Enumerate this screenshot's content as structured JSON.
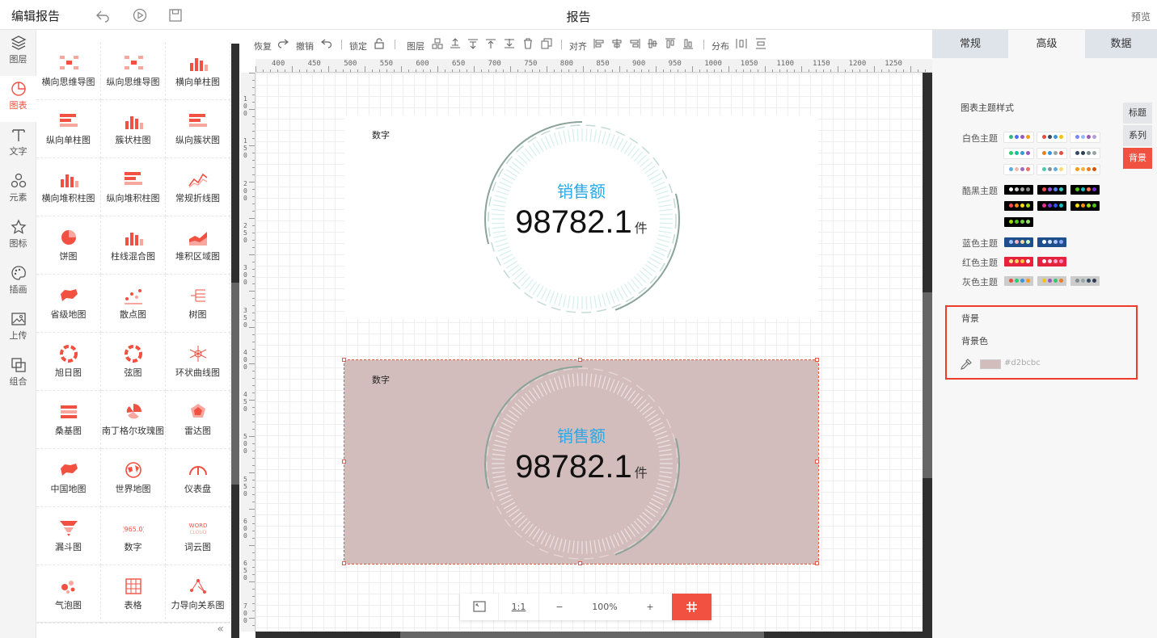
{
  "header": {
    "title": "编辑报告",
    "report_name": "报告",
    "preview": "预览"
  },
  "rail": [
    {
      "label": "图层",
      "icon": "layers-icon"
    },
    {
      "label": "图表",
      "icon": "chart-icon",
      "active": true
    },
    {
      "label": "文字",
      "icon": "text-icon"
    },
    {
      "label": "元素",
      "icon": "shapes-icon"
    },
    {
      "label": "图标",
      "icon": "star-icon"
    },
    {
      "label": "插画",
      "icon": "palette-icon"
    },
    {
      "label": "上传",
      "icon": "upload-image-icon"
    },
    {
      "label": "组合",
      "icon": "group-icon"
    }
  ],
  "palette": [
    "横向思维导图",
    "纵向思维导图",
    "横向单柱图",
    "纵向单柱图",
    "簇状柱图",
    "纵向簇状图",
    "横向堆积柱图",
    "纵向堆积柱图",
    "常规折线图",
    "饼图",
    "柱线混合图",
    "堆积区域图",
    "省级地图",
    "散点图",
    "树图",
    "旭日图",
    "弦图",
    "环状曲线图",
    "桑基图",
    "南丁格尔玫瑰图",
    "雷达图",
    "中国地图",
    "世界地图",
    "仪表盘",
    "漏斗图",
    "数字",
    "词云图",
    "气泡图",
    "表格",
    "力导向关系图"
  ],
  "toolbar": {
    "redo": "恢复",
    "undo": "撤销",
    "lock": "锁定",
    "layer": "图层",
    "align": "对齐",
    "distribute": "分布"
  },
  "ruler": {
    "h": [
      "400",
      "450",
      "500",
      "550",
      "600",
      "650",
      "700",
      "750",
      "800",
      "850",
      "900",
      "950",
      "1000",
      "1050",
      "1100",
      "1150",
      "1200",
      "1250"
    ],
    "v": [
      "100",
      "150",
      "200",
      "250",
      "300",
      "350",
      "400",
      "450",
      "500",
      "550",
      "600",
      "650",
      "700"
    ]
  },
  "charts": [
    {
      "label": "数字",
      "metric": "销售额",
      "value": "98782.1",
      "unit": "件",
      "background": "#ffffff"
    },
    {
      "label": "数字",
      "metric": "销售额",
      "value": "98782.1",
      "unit": "件",
      "background": "#d2bcbc",
      "selected": true
    }
  ],
  "zoom": {
    "fit": "fit-icon",
    "ratio": "1:1",
    "minus": "−",
    "level": "100%",
    "plus": "+"
  },
  "panel": {
    "tabs": [
      "常规",
      "高级",
      "数据"
    ],
    "active_tab": "高级",
    "section": "图表主题样式",
    "theme_rows": [
      {
        "name": "白色主题",
        "swatches": [
          {
            "bg": "#ffffff",
            "dots": [
              "#3cb371",
              "#4a6cf7",
              "#9b59b6",
              "#f39c12"
            ]
          },
          {
            "bg": "#ffffff",
            "dots": [
              "#e74c3c",
              "#34495e",
              "#3498db",
              "#f1c40f"
            ]
          },
          {
            "bg": "#ffffff",
            "dots": [
              "#7c83fd",
              "#96baff",
              "#9b59b6",
              "#b39ddb"
            ]
          },
          {
            "bg": "#ffffff",
            "dots": [
              "#2ecc71",
              "#1abc9c",
              "#3498db",
              "#9b59b6"
            ]
          },
          {
            "bg": "#ffffff",
            "dots": [
              "#e67e22",
              "#3498db",
              "#95a5a6",
              "#e74c3c"
            ]
          },
          {
            "bg": "#ffffff",
            "dots": [
              "#34495e",
              "#2c3e50",
              "#7f8c8d",
              "#95a5a6"
            ]
          },
          {
            "bg": "#ffffff",
            "dots": [
              "#5dade2",
              "#f5b7b1",
              "#a569bd",
              "#ec7063"
            ]
          },
          {
            "bg": "#ffffff",
            "dots": [
              "#48c9b0",
              "#85929e",
              "#5dade2",
              "#f7dc6f"
            ]
          },
          {
            "bg": "#ffffff",
            "dots": [
              "#f39c12",
              "#f5b041",
              "#e67e22",
              "#d35400"
            ]
          }
        ]
      },
      {
        "name": "酷黑主题",
        "swatches": [
          {
            "bg": "#000000",
            "dots": [
              "#ffffff",
              "#d0d0d0",
              "#aaaaaa",
              "#888888"
            ]
          },
          {
            "bg": "#000000",
            "dots": [
              "#ff4d4f",
              "#9254de",
              "#597ef7",
              "#36cfc9"
            ]
          },
          {
            "bg": "#000000",
            "dots": [
              "#52c41a",
              "#13c2c2",
              "#ff7a45",
              "#722ed1"
            ]
          },
          {
            "bg": "#000000",
            "dots": [
              "#ff4d4f",
              "#fa8c16",
              "#fadb14",
              "#a0d911"
            ]
          },
          {
            "bg": "#000000",
            "dots": [
              "#eb2f96",
              "#722ed1",
              "#2f54eb",
              "#13c2c2"
            ]
          },
          {
            "bg": "#000000",
            "dots": [
              "#fadb14",
              "#fa8c16",
              "#a0d911",
              "#52c41a"
            ]
          },
          {
            "bg": "#000000",
            "dots": [
              "#a0d911",
              "#52c41a",
              "#73d13d",
              "#95de64"
            ]
          }
        ]
      },
      {
        "name": "蓝色主题",
        "swatches": [
          {
            "bg": "#1f4e8c",
            "dots": [
              "#a0c4ff",
              "#ffb3c1",
              "#ffd6a5",
              "#caffbf"
            ]
          },
          {
            "bg": "#1f4e8c",
            "dots": [
              "#ffffff",
              "#d6e4ff",
              "#adc6ff",
              "#85a5ff"
            ]
          }
        ]
      },
      {
        "name": "红色主题",
        "swatches": [
          {
            "bg": "#e6223c",
            "dots": [
              "#ffe58f",
              "#ffd666",
              "#ffc53d",
              "#ffffff"
            ]
          },
          {
            "bg": "#e6223c",
            "dots": [
              "#ffffff",
              "#ffd6e7",
              "#ffadd2",
              "#ff85c0"
            ]
          }
        ]
      },
      {
        "name": "灰色主题",
        "swatches": [
          {
            "bg": "#cccccc",
            "dots": [
              "#e74c3c",
              "#2ecc71",
              "#3498db",
              "#f39c12"
            ]
          },
          {
            "bg": "#cccccc",
            "dots": [
              "#f1c40f",
              "#9b59b6",
              "#2ecc71",
              "#e67e22"
            ]
          },
          {
            "bg": "#cccccc",
            "dots": [
              "#7f8c8d",
              "#95a5a6",
              "#34495e",
              "#2c3e50"
            ]
          }
        ]
      }
    ],
    "side_tabs": [
      "标题",
      "系列",
      "背景"
    ],
    "active_side_tab": "背景",
    "background": {
      "section": "背景",
      "color_label": "背景色",
      "color": "#d2bcbc",
      "color_text": "#d2bcbc"
    }
  }
}
